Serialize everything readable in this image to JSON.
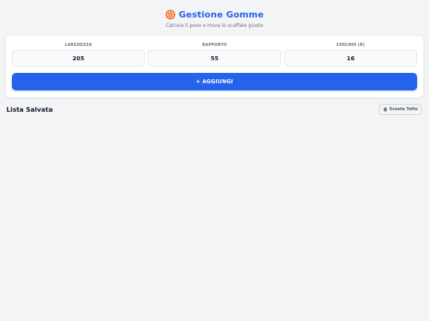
{
  "header": {
    "title": "Gestione Gomme",
    "subtitle": "Calcola il peso e trova lo scaffale giusto",
    "icon": "wheel-icon"
  },
  "form": {
    "fields": [
      {
        "label": "LARGHEZZA",
        "value": "205"
      },
      {
        "label": "RAPPORTO",
        "value": "55"
      },
      {
        "label": "CERCHIO (R)",
        "value": "16"
      }
    ],
    "add_label": "+ AGGIUNGI"
  },
  "list": {
    "title": "Lista Salvata",
    "clear_label": "Svuota Tutto",
    "clear_icon": "trash-icon",
    "items": []
  },
  "colors": {
    "accent": "#2563eb",
    "wheel": "#ea580c",
    "background": "#f3f4f6"
  }
}
